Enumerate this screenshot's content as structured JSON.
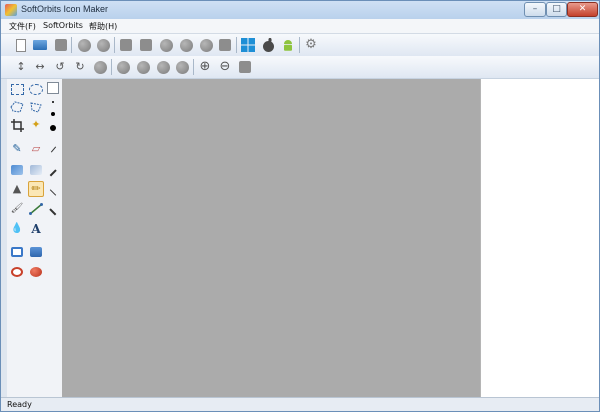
{
  "window": {
    "title": "SoftOrbits Icon Maker",
    "controls": {
      "minimize": "–",
      "maximize": "□",
      "close": "✕"
    }
  },
  "menu": {
    "items": [
      {
        "label": "文件(F)"
      },
      {
        "label": "SoftOrbits"
      },
      {
        "label": "帮助(H)"
      }
    ]
  },
  "glyphs": {
    "align_vertical": "↕",
    "align_horizontal": "↔",
    "rotate_left": "↺",
    "rotate_right": "↻",
    "zoom_in": "⊕",
    "zoom_out": "⊖",
    "eyedropper": "✎",
    "eraser": "▱",
    "pencil": "✏",
    "wand": "✦",
    "brush": "🖌",
    "drop": "💧",
    "text_tool": "A",
    "stamp": "▲",
    "apple": "",
    "gear": "⚙"
  },
  "colors": {
    "canvas": "#ababab",
    "windows_logo": "#1e8fd6",
    "android_logo": "#8ec43e",
    "accent_selected": "#d9a33b"
  },
  "status": {
    "text": "Ready"
  }
}
